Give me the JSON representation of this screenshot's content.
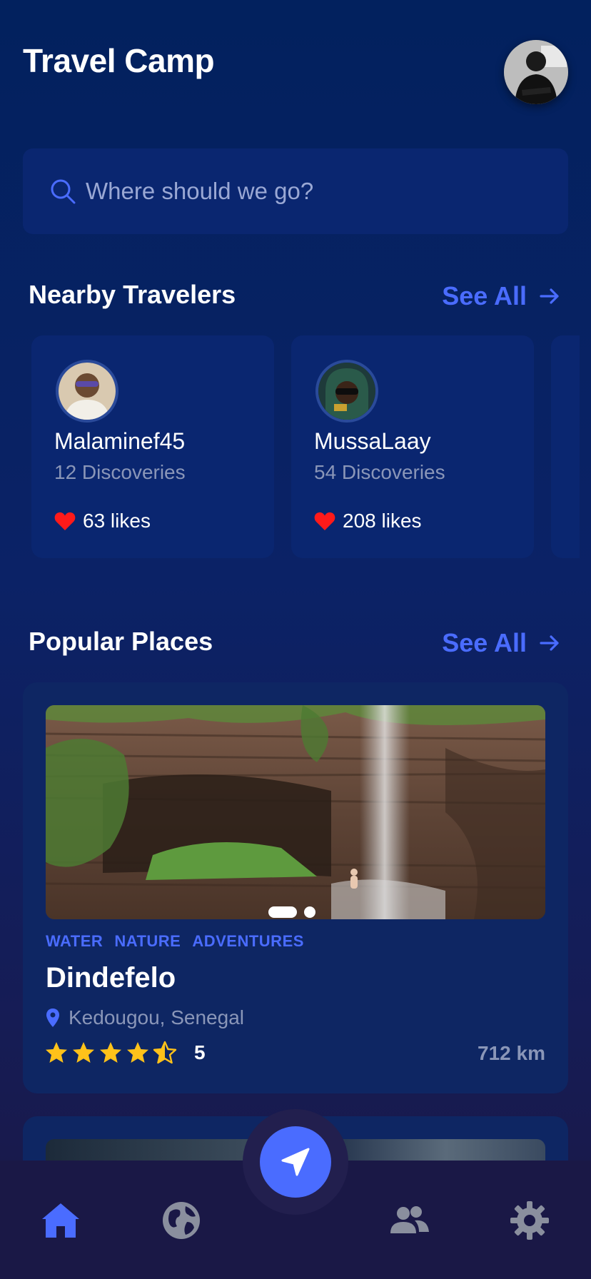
{
  "app": {
    "title": "Travel Camp"
  },
  "search": {
    "placeholder": "Where should we go?"
  },
  "nearby": {
    "title": "Nearby Travelers",
    "see_all": "See All",
    "travelers": [
      {
        "name": "Malaminef45",
        "discoveries": "12 Discoveries",
        "likes": "63 likes"
      },
      {
        "name": "MussaLaay",
        "discoveries": "54 Discoveries",
        "likes": "208 likes"
      }
    ]
  },
  "popular": {
    "title": "Popular Places",
    "see_all": "See All",
    "places": [
      {
        "tags": [
          "WATER",
          "NATURE",
          "ADVENTURES"
        ],
        "name": "Dindefelo",
        "location": "Kedougou, Senegal",
        "rating": 4.5,
        "rating_label": "5",
        "distance": "712 km",
        "image_slide": 1,
        "image_slides": 2
      }
    ]
  },
  "nav": {
    "items": [
      "home-icon",
      "globe-icon",
      "location-arrow-icon",
      "users-icon",
      "gear-icon"
    ],
    "active": "home-icon"
  },
  "colors": {
    "accent": "#4a6cff",
    "background": "#02215e",
    "card": "#0a2670",
    "heart": "#ff1a1a",
    "star": "#ffc21a",
    "muted_text": "#8a96b8"
  }
}
